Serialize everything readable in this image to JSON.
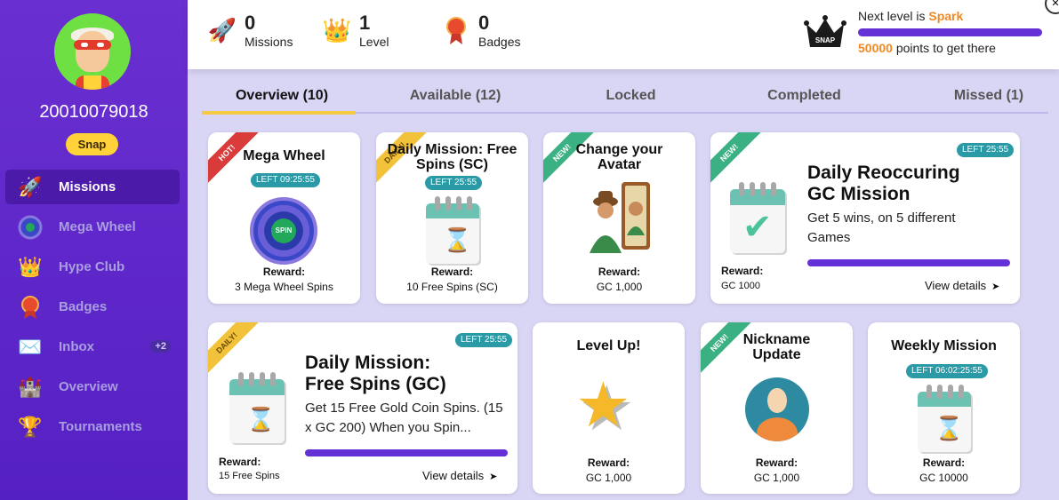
{
  "user": {
    "id": "20010079018",
    "rank_badge": "Snap"
  },
  "sidebar": {
    "items": [
      {
        "label": "Missions",
        "icon": "rocket-icon",
        "active": true
      },
      {
        "label": "Mega Wheel",
        "icon": "wheel-icon"
      },
      {
        "label": "Hype Club",
        "icon": "crown-icon"
      },
      {
        "label": "Badges",
        "icon": "medal-icon"
      },
      {
        "label": "Inbox",
        "icon": "envelope-icon",
        "count": "+2"
      },
      {
        "label": "Overview",
        "icon": "castle-icon"
      },
      {
        "label": "Tournaments",
        "icon": "trophy-icon"
      }
    ]
  },
  "stats": [
    {
      "value": "0",
      "label": "Missions",
      "icon": "rocket-icon"
    },
    {
      "value": "1",
      "label": "Level",
      "icon": "crown-icon"
    },
    {
      "value": "0",
      "label": "Badges",
      "icon": "medal-icon"
    }
  ],
  "level": {
    "crown_text": "SNAP",
    "next_prefix": "Next level is ",
    "next_name": "Spark",
    "points": "50000",
    "points_suffix": " points to get there"
  },
  "tabs": [
    {
      "label": "Overview (10)",
      "active": true
    },
    {
      "label": "Available (12)"
    },
    {
      "label": "Locked"
    },
    {
      "label": "Completed"
    },
    {
      "label": "Missed (1)"
    }
  ],
  "missions": {
    "mega_wheel": {
      "ribbon": "HOT!",
      "title": "Mega Wheel",
      "timer": "LEFT 09:25:55",
      "spin": "SPIN",
      "reward_label": "Reward:",
      "reward": "3 Mega Wheel Spins"
    },
    "daily_sc": {
      "ribbon": "DAILY!",
      "title": "Daily Mission: Free Spins (SC)",
      "timer": "LEFT 25:55",
      "reward_label": "Reward:",
      "reward": "10 Free Spins (SC)"
    },
    "avatar": {
      "ribbon": "NEW!",
      "title": "Change your Avatar",
      "reward_label": "Reward:",
      "reward": "GC 1,000"
    },
    "reoccuring": {
      "ribbon": "NEW!",
      "title_line1": "Daily Reoccuring",
      "title_line2": "GC Mission",
      "timer": "LEFT 25:55",
      "desc": "Get 5 wins, on 5 different Games",
      "reward_label": "Reward:",
      "reward": "GC 1000",
      "view": "View details",
      "progress": 1.0
    },
    "daily_gc": {
      "ribbon": "DAILY!",
      "title_line1": "Daily Mission:",
      "title_line2": "Free Spins (GC)",
      "timer": "LEFT 25:55",
      "desc": "Get 15 Free Gold Coin Spins. (15 x GC 200) When you Spin...",
      "reward_label": "Reward:",
      "reward": "15 Free Spins",
      "view": "View details",
      "progress": 1.0
    },
    "level_up": {
      "title": "Level Up!",
      "reward_label": "Reward:",
      "reward": "GC 1,000"
    },
    "nickname": {
      "ribbon": "NEW!",
      "title": "Nickname Update",
      "reward_label": "Reward:",
      "reward": "GC 1,000"
    },
    "weekly": {
      "title": "Weekly Mission",
      "timer": "LEFT 06:02:25:55",
      "reward_label": "Reward:",
      "reward": "GC 10000"
    }
  },
  "colors": {
    "sidebar": "#5f27cd",
    "accent": "#6431d6",
    "orange": "#f08a24",
    "timer": "#2a9aa6",
    "tab_underline": "#f6c945"
  }
}
